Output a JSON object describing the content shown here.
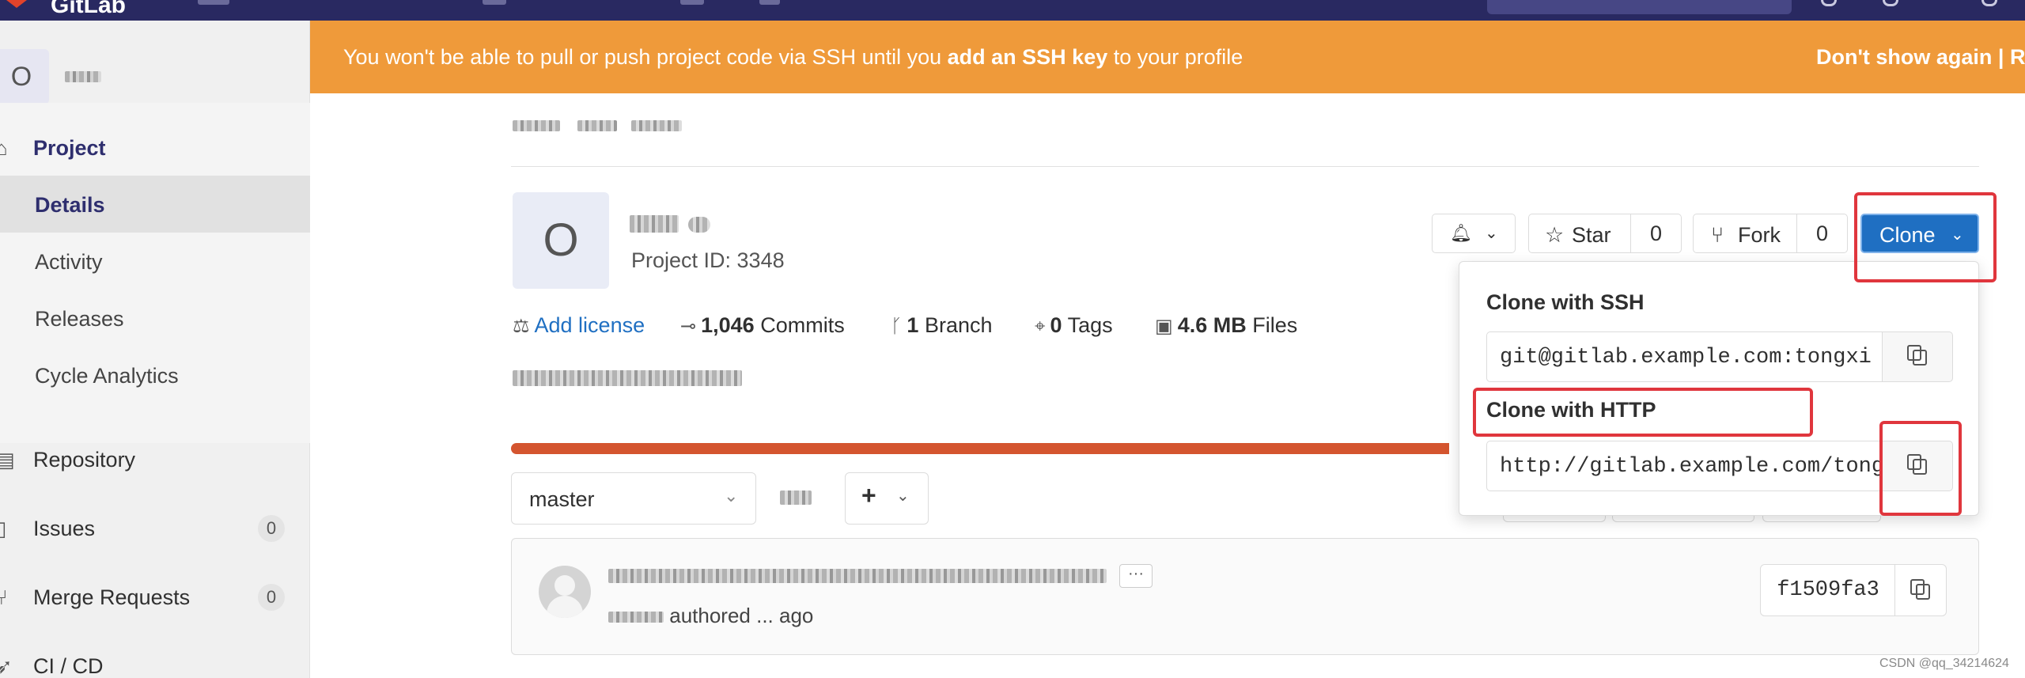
{
  "app": {
    "brand": "GitLab",
    "accent": "#292961"
  },
  "sidebar": {
    "avatar_letter": "O",
    "section": {
      "label": "Project",
      "icon": "home-icon"
    },
    "subitems": [
      {
        "label": "Details",
        "active": true
      },
      {
        "label": "Activity",
        "active": false
      },
      {
        "label": "Releases",
        "active": false
      },
      {
        "label": "Cycle Analytics",
        "active": false
      }
    ],
    "items": [
      {
        "label": "Repository",
        "icon": "book-icon"
      },
      {
        "label": "Issues",
        "icon": "issues-icon",
        "count": "0"
      },
      {
        "label": "Merge Requests",
        "icon": "merge-request-icon",
        "count": "0"
      },
      {
        "label": "CI / CD",
        "icon": "rocket-icon"
      }
    ]
  },
  "alert": {
    "text_before": "You won't be able to pull or push project code via SSH until you ",
    "link": "add an SSH key",
    "text_after": " to your profile",
    "dismiss": "Don't show again | R",
    "color": "#ef9a3a"
  },
  "project": {
    "avatar_letter": "O",
    "id_label": "Project ID: 3348",
    "add_license": "Add license",
    "commits_count": "1,046",
    "commits_label": "Commits",
    "branches_count": "1",
    "branches_label": "Branch",
    "tags_count": "0",
    "tags_label": "Tags",
    "files_size": "4.6 MB",
    "files_label": "Files"
  },
  "actions": {
    "star_label": "Star",
    "star_count": "0",
    "fork_label": "Fork",
    "fork_count": "0",
    "clone_label": "Clone"
  },
  "clone_dropdown": {
    "ssh_label": "Clone with SSH",
    "ssh_url": "git@gitlab.example.com:tongxi",
    "http_label": "Clone with HTTP",
    "http_url": "http://gitlab.example.com/tongxi"
  },
  "branch": {
    "selected": "master",
    "add_label": "+"
  },
  "commit": {
    "author_suffix": "authored ... ago",
    "sha": "f1509fa3",
    "ellipsis": "···"
  },
  "watermark": "CSDN @qq_34214624"
}
